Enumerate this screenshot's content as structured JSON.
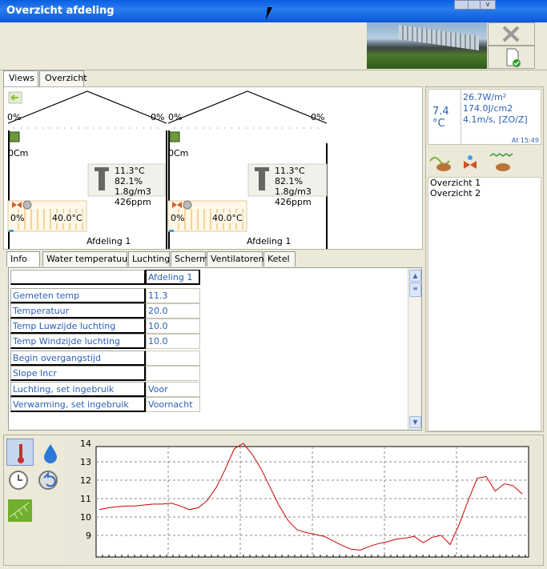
{
  "window": {
    "title": "Overzicht afdeling"
  },
  "tabs_top": [
    "Views",
    "Overzicht"
  ],
  "compartments": [
    {
      "left_pct": "0%",
      "right_pct": "0%",
      "screen": "0Cm",
      "temp": "11.3°C",
      "rh": "82.1%",
      "abs": "1.8g/m3",
      "co2": "426ppm",
      "pipe_pct": "0%",
      "pipe_temp": "40.0°C",
      "name": "Afdeling 1"
    },
    {
      "left_pct": "0%",
      "right_pct": "0%",
      "screen": "0Cm",
      "temp": "11.3°C",
      "rh": "82.1%",
      "abs": "1.8g/m3",
      "co2": "426ppm",
      "pipe_pct": "0%",
      "pipe_temp": "40.0°C",
      "name": "Afdeling 1"
    }
  ],
  "weather": {
    "temp": "7.4",
    "unit": "°C",
    "radiation": "26.7W/m²",
    "sum": "174.0J/cm2",
    "wind": "4.1m/s, [ZO/Z]",
    "time": "At 15:49"
  },
  "overview_list": [
    "Overzicht 1",
    "Overzicht 2"
  ],
  "tabs_mid": [
    "Info",
    "Water temperatuur",
    "Luchting",
    "Scherm",
    "Ventilatoren",
    "Ketel"
  ],
  "table": {
    "header": "Afdeling 1",
    "rows": [
      {
        "label": "Gemeten temp",
        "value": "11.3"
      },
      {
        "label": "Temperatuur",
        "value": "20.0"
      },
      {
        "label": "Temp Luwzijde luchting",
        "value": "10.0"
      },
      {
        "label": "Temp Windzijde luchting",
        "value": "10.0"
      },
      {
        "label": "Begin overgangstijd",
        "value": ""
      },
      {
        "label": "Slope Incr",
        "value": ""
      },
      {
        "label": "Luchting, set ingebruik",
        "value": "Voor"
      },
      {
        "label": "Verwarming, set ingebruik",
        "value": "Voornacht"
      }
    ]
  },
  "chart_data": {
    "type": "line",
    "ylim": [
      8,
      14
    ],
    "yticks": [
      "14",
      "13",
      "12",
      "11",
      "10",
      "9"
    ],
    "grid": true,
    "series": [
      {
        "color": "#cc0000",
        "values": [
          10.4,
          10.5,
          10.55,
          10.6,
          10.6,
          10.65,
          10.7,
          10.7,
          10.75,
          10.6,
          10.4,
          10.5,
          10.9,
          11.6,
          12.6,
          13.7,
          14.0,
          13.4,
          12.6,
          11.6,
          10.6,
          9.8,
          9.3,
          9.15,
          9.05,
          8.95,
          8.7,
          8.45,
          8.25,
          8.2,
          8.4,
          8.55,
          8.65,
          8.8,
          8.85,
          8.95,
          8.6,
          8.9,
          9.0,
          8.5,
          9.6,
          10.9,
          12.1,
          12.2,
          11.4,
          11.8,
          11.7,
          11.25
        ]
      }
    ]
  },
  "colors": {
    "accent": "#2b5fb4",
    "title": "#0a5fe0",
    "line": "#cc0000"
  }
}
